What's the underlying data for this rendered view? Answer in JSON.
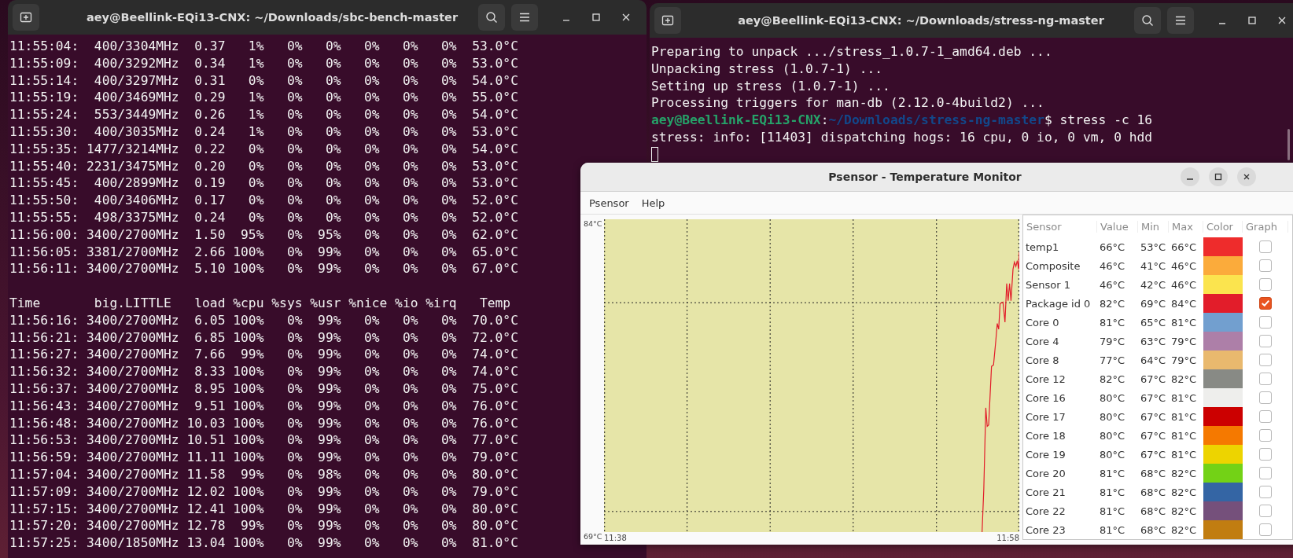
{
  "left_terminal": {
    "title": "aey@Beellink-EQi13-CNX: ~/Downloads/sbc-bench-master",
    "output_lines": [
      "11:55:04:  400/3304MHz  0.37   1%   0%   0%   0%   0%   0%  53.0°C",
      "11:55:09:  400/3292MHz  0.34   1%   0%   0%   0%   0%   0%  53.0°C",
      "11:55:14:  400/3297MHz  0.31   0%   0%   0%   0%   0%   0%  54.0°C",
      "11:55:19:  400/3469MHz  0.29   1%   0%   0%   0%   0%   0%  55.0°C",
      "11:55:24:  553/3449MHz  0.26   1%   0%   0%   0%   0%   0%  54.0°C",
      "11:55:30:  400/3035MHz  0.24   1%   0%   0%   0%   0%   0%  53.0°C",
      "11:55:35: 1477/3214MHz  0.22   0%   0%   0%   0%   0%   0%  54.0°C",
      "11:55:40: 2231/3475MHz  0.20   0%   0%   0%   0%   0%   0%  53.0°C",
      "11:55:45:  400/2899MHz  0.19   0%   0%   0%   0%   0%   0%  53.0°C",
      "11:55:50:  400/3406MHz  0.17   0%   0%   0%   0%   0%   0%  52.0°C",
      "11:55:55:  498/3375MHz  0.24   0%   0%   0%   0%   0%   0%  52.0°C",
      "11:56:00: 3400/2700MHz  1.50  95%   0%  95%   0%   0%   0%  62.0°C",
      "11:56:05: 3381/2700MHz  2.66 100%   0%  99%   0%   0%   0%  65.0°C",
      "11:56:11: 3400/2700MHz  5.10 100%   0%  99%   0%   0%   0%  67.0°C"
    ],
    "table_header": "Time       big.LITTLE   load %cpu %sys %usr %nice %io %irq   Temp",
    "table_lines": [
      "11:56:16: 3400/2700MHz  6.05 100%   0%  99%   0%   0%   0%  70.0°C",
      "11:56:21: 3400/2700MHz  6.85 100%   0%  99%   0%   0%   0%  72.0°C",
      "11:56:27: 3400/2700MHz  7.66  99%   0%  99%   0%   0%   0%  74.0°C",
      "11:56:32: 3400/2700MHz  8.33 100%   0%  99%   0%   0%   0%  74.0°C",
      "11:56:37: 3400/2700MHz  8.95 100%   0%  99%   0%   0%   0%  75.0°C",
      "11:56:43: 3400/2700MHz  9.51 100%   0%  99%   0%   0%   0%  76.0°C",
      "11:56:48: 3400/2700MHz 10.03 100%   0%  99%   0%   0%   0%  76.0°C",
      "11:56:53: 3400/2700MHz 10.51 100%   0%  99%   0%   0%   0%  77.0°C",
      "11:56:59: 3400/2700MHz 11.11 100%   0%  99%   0%   0%   0%  79.0°C",
      "11:57:04: 3400/2700MHz 11.58  99%   0%  98%   0%   0%   0%  80.0°C",
      "11:57:09: 3400/2700MHz 12.02 100%   0%  99%   0%   0%   0%  79.0°C",
      "11:57:15: 3400/2700MHz 12.41 100%   0%  99%   0%   0%   0%  80.0°C",
      "11:57:20: 3400/2700MHz 12.78  99%   0%  99%   0%   0%   0%  80.0°C",
      "11:57:25: 3400/1850MHz 13.04 100%   0%  99%   0%   0%   0%  81.0°C"
    ]
  },
  "right_terminal": {
    "title": "aey@Beellink-EQi13-CNX: ~/Downloads/stress-ng-master",
    "lines": [
      "Preparing to unpack .../stress_1.0.7-1_amd64.deb ...",
      "Unpacking stress (1.0.7-1) ...",
      "Setting up stress (1.0.7-1) ...",
      "Processing triggers for man-db (2.12.0-4build2) ..."
    ],
    "prompt": {
      "user_host": "aey@Beellink-EQi13-CNX",
      "separator": ":",
      "path": "~/Downloads/stress-ng-master",
      "command": "$ stress -c 16"
    },
    "after_prompt": [
      "stress: info: [11403] dispatching hogs: 16 cpu, 0 io, 0 vm, 0 hdd"
    ]
  },
  "psensor": {
    "title": "Psensor - Temperature Monitor",
    "menu": [
      "Psensor",
      "Help"
    ],
    "graph": {
      "y_max_label": "84°C",
      "y_min_label": "69°C",
      "x_start_label": "11:38",
      "x_end_label": "11:58"
    },
    "table": {
      "columns": [
        "Sensor",
        "Value",
        "Min",
        "Max",
        "Color",
        "Graph"
      ],
      "rows": [
        {
          "sensor": "temp1",
          "value": "66°C",
          "min": "53°C",
          "max": "66°C",
          "color": "#ee2c2c",
          "checked": false
        },
        {
          "sensor": "Composite",
          "value": "46°C",
          "min": "41°C",
          "max": "46°C",
          "color": "#fbab3b",
          "checked": false
        },
        {
          "sensor": "Sensor 1",
          "value": "46°C",
          "min": "42°C",
          "max": "46°C",
          "color": "#fbe44e",
          "checked": false
        },
        {
          "sensor": "Package id 0",
          "value": "82°C",
          "min": "69°C",
          "max": "84°C",
          "color": "#e21d2a",
          "checked": true
        },
        {
          "sensor": "Core 0",
          "value": "81°C",
          "min": "65°C",
          "max": "81°C",
          "color": "#729fcf",
          "checked": false
        },
        {
          "sensor": "Core 4",
          "value": "79°C",
          "min": "63°C",
          "max": "79°C",
          "color": "#ad7fa8",
          "checked": false
        },
        {
          "sensor": "Core 8",
          "value": "77°C",
          "min": "64°C",
          "max": "79°C",
          "color": "#e9b96e",
          "checked": false
        },
        {
          "sensor": "Core 12",
          "value": "82°C",
          "min": "67°C",
          "max": "82°C",
          "color": "#888a85",
          "checked": false
        },
        {
          "sensor": "Core 16",
          "value": "80°C",
          "min": "67°C",
          "max": "81°C",
          "color": "#eeeeec",
          "checked": false
        },
        {
          "sensor": "Core 17",
          "value": "80°C",
          "min": "67°C",
          "max": "81°C",
          "color": "#cc0000",
          "checked": false
        },
        {
          "sensor": "Core 18",
          "value": "80°C",
          "min": "67°C",
          "max": "81°C",
          "color": "#f57900",
          "checked": false
        },
        {
          "sensor": "Core 19",
          "value": "80°C",
          "min": "67°C",
          "max": "81°C",
          "color": "#edd400",
          "checked": false
        },
        {
          "sensor": "Core 20",
          "value": "81°C",
          "min": "68°C",
          "max": "82°C",
          "color": "#73d216",
          "checked": false
        },
        {
          "sensor": "Core 21",
          "value": "81°C",
          "min": "68°C",
          "max": "82°C",
          "color": "#3465a4",
          "checked": false
        },
        {
          "sensor": "Core 22",
          "value": "81°C",
          "min": "68°C",
          "max": "82°C",
          "color": "#75507b",
          "checked": false
        },
        {
          "sensor": "Core 23",
          "value": "81°C",
          "min": "68°C",
          "max": "82°C",
          "color": "#c17d11",
          "checked": false
        }
      ]
    }
  }
}
